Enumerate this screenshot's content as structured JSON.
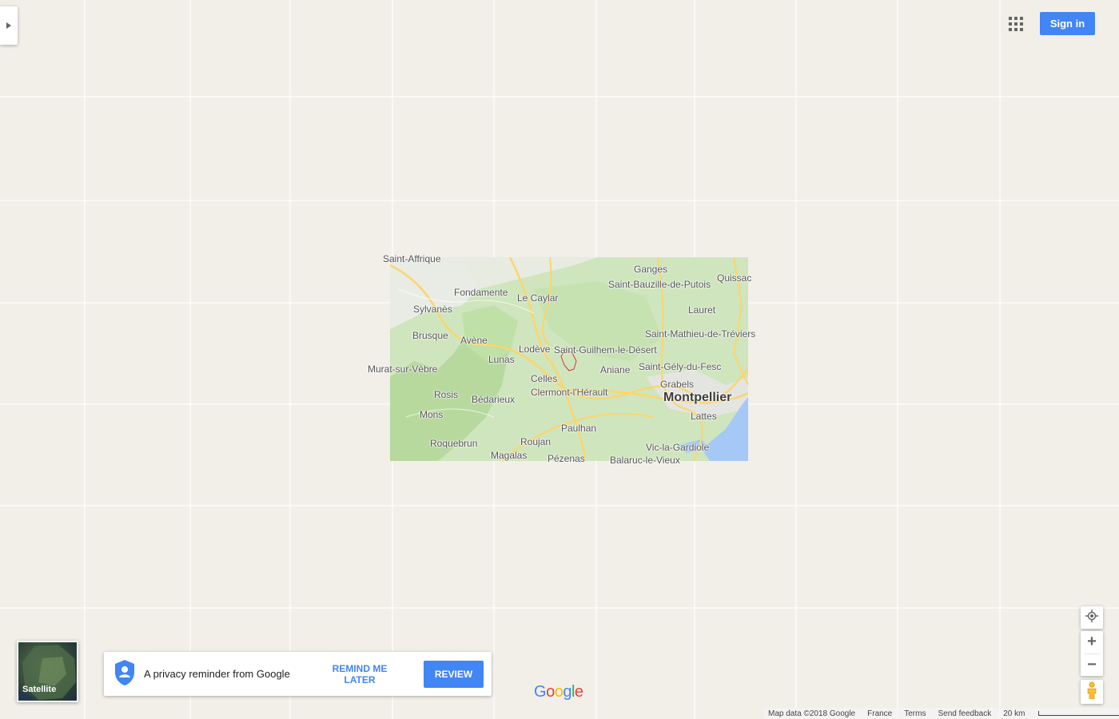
{
  "header": {
    "sign_in_label": "Sign in"
  },
  "icons": {
    "side_panel_toggle": "triangle-right-icon",
    "apps": "grid-icon",
    "locate": "crosshair-icon",
    "pegman": "pegman-icon",
    "privacy": "shield-person-icon"
  },
  "map": {
    "places": [
      {
        "name": "Saint-Affrique",
        "size": "mid"
      },
      {
        "name": "Fondamente",
        "size": "mid"
      },
      {
        "name": "Le Caylar",
        "size": "mid"
      },
      {
        "name": "Ganges",
        "size": "mid"
      },
      {
        "name": "Saint-Bauzille-de-Putois",
        "size": "mid"
      },
      {
        "name": "Quissac",
        "size": "mid"
      },
      {
        "name": "Sylvanès",
        "size": "mid"
      },
      {
        "name": "Lauret",
        "size": "mid"
      },
      {
        "name": "Brusque",
        "size": "mid"
      },
      {
        "name": "Avène",
        "size": "mid"
      },
      {
        "name": "Saint-Mathieu-de-Tréviers",
        "size": "mid"
      },
      {
        "name": "Lodève",
        "size": "mid"
      },
      {
        "name": "Saint-Guilhem-le-Désert",
        "size": "mid"
      },
      {
        "name": "Lunas",
        "size": "mid"
      },
      {
        "name": "Murat-sur-Vèbre",
        "size": "mid"
      },
      {
        "name": "Aniane",
        "size": "mid"
      },
      {
        "name": "Saint-Gély-du-Fesc",
        "size": "mid"
      },
      {
        "name": "Celles",
        "size": "mid"
      },
      {
        "name": "Grabels",
        "size": "mid"
      },
      {
        "name": "Rosis",
        "size": "mid"
      },
      {
        "name": "Clermont-l'Hérault",
        "size": "mid"
      },
      {
        "name": "Montpellier",
        "size": "big"
      },
      {
        "name": "Bédarieux",
        "size": "mid"
      },
      {
        "name": "Mons",
        "size": "mid"
      },
      {
        "name": "Lattes",
        "size": "mid"
      },
      {
        "name": "Paulhan",
        "size": "mid"
      },
      {
        "name": "Roquebrun",
        "size": "mid"
      },
      {
        "name": "Roujan",
        "size": "mid"
      },
      {
        "name": "Vic-la-Gardiole",
        "size": "mid"
      },
      {
        "name": "Magalas",
        "size": "mid"
      },
      {
        "name": "Pézenas",
        "size": "mid"
      },
      {
        "name": "Balaruc-le-Vieux",
        "size": "mid"
      }
    ],
    "colors": {
      "background": "#f2efe9",
      "land_green": "#c9e4b4",
      "water": "#a5c8f7",
      "road_yellow": "#fcd56b",
      "boundary_red": "#d33"
    }
  },
  "satellite": {
    "label": "Satellite"
  },
  "privacy": {
    "text": "A privacy reminder from Google",
    "remind_label": "REMIND ME LATER",
    "review_label": "REVIEW"
  },
  "logo": {
    "letters": [
      "G",
      "o",
      "o",
      "g",
      "l",
      "e"
    ],
    "colors": [
      "#4285f4",
      "#ea4335",
      "#fbbc05",
      "#4285f4",
      "#34a853",
      "#ea4335"
    ]
  },
  "controls": {
    "zoom_in_label": "+",
    "zoom_out_label": "−"
  },
  "footer": {
    "map_data": "Map data ©2018 Google",
    "region": "France",
    "terms": "Terms",
    "feedback": "Send feedback",
    "scale_label": "20 km"
  }
}
